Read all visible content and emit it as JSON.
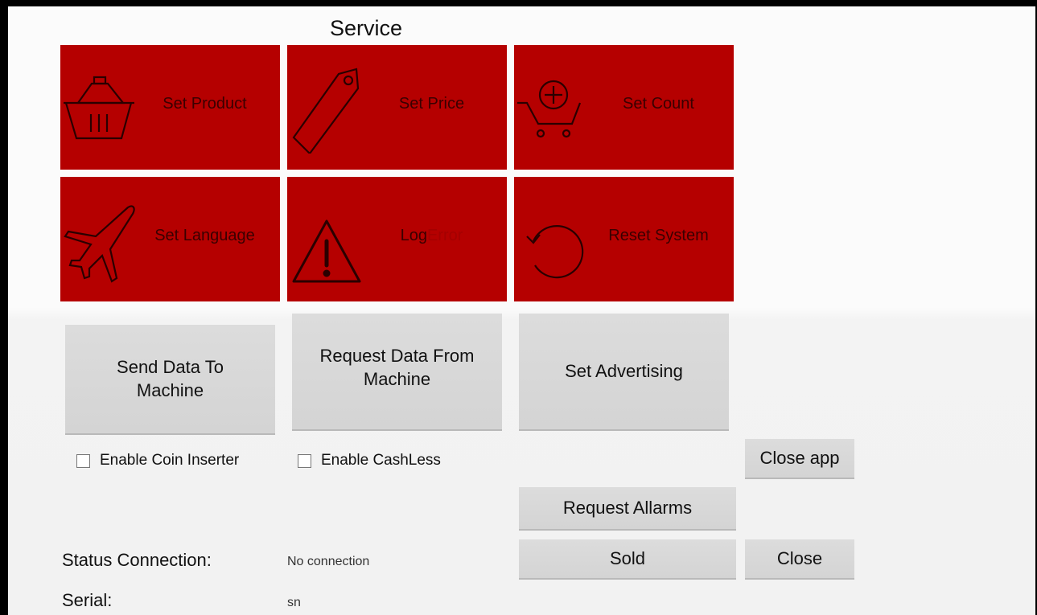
{
  "screen": {
    "title": "Service"
  },
  "tiles": [
    {
      "label": "Set Product",
      "icon": "basket-icon"
    },
    {
      "label": "Set Price",
      "icon": "price-tag-icon"
    },
    {
      "label": "Set Count",
      "icon": "cart-plus-icon"
    },
    {
      "label": "Set Language",
      "icon": "airplane-icon"
    },
    {
      "label": "Log",
      "label_dim": "Error",
      "icon": "warning-icon"
    },
    {
      "label": "Reset System",
      "icon": "reset-icon"
    }
  ],
  "actions": {
    "send_data": "Send Data To Machine",
    "request_data": "Request Data From Machine",
    "set_advertising": "Set Advertising",
    "close_app": "Close app",
    "request_allarms": "Request Allarms",
    "sold": "Sold",
    "close": "Close"
  },
  "options": {
    "coin_inserter": {
      "label": "Enable Coin Inserter",
      "checked": false
    },
    "cashless": {
      "label": "Enable CashLess",
      "checked": false
    }
  },
  "status": {
    "connection_label": "Status Connection:",
    "connection_value": "No connection",
    "serial_label": "Serial:",
    "serial_value": "sn"
  },
  "colors": {
    "tile_bg": "#b50000",
    "button_bg": "#d8d8d8",
    "background": "#f6f6f6"
  }
}
